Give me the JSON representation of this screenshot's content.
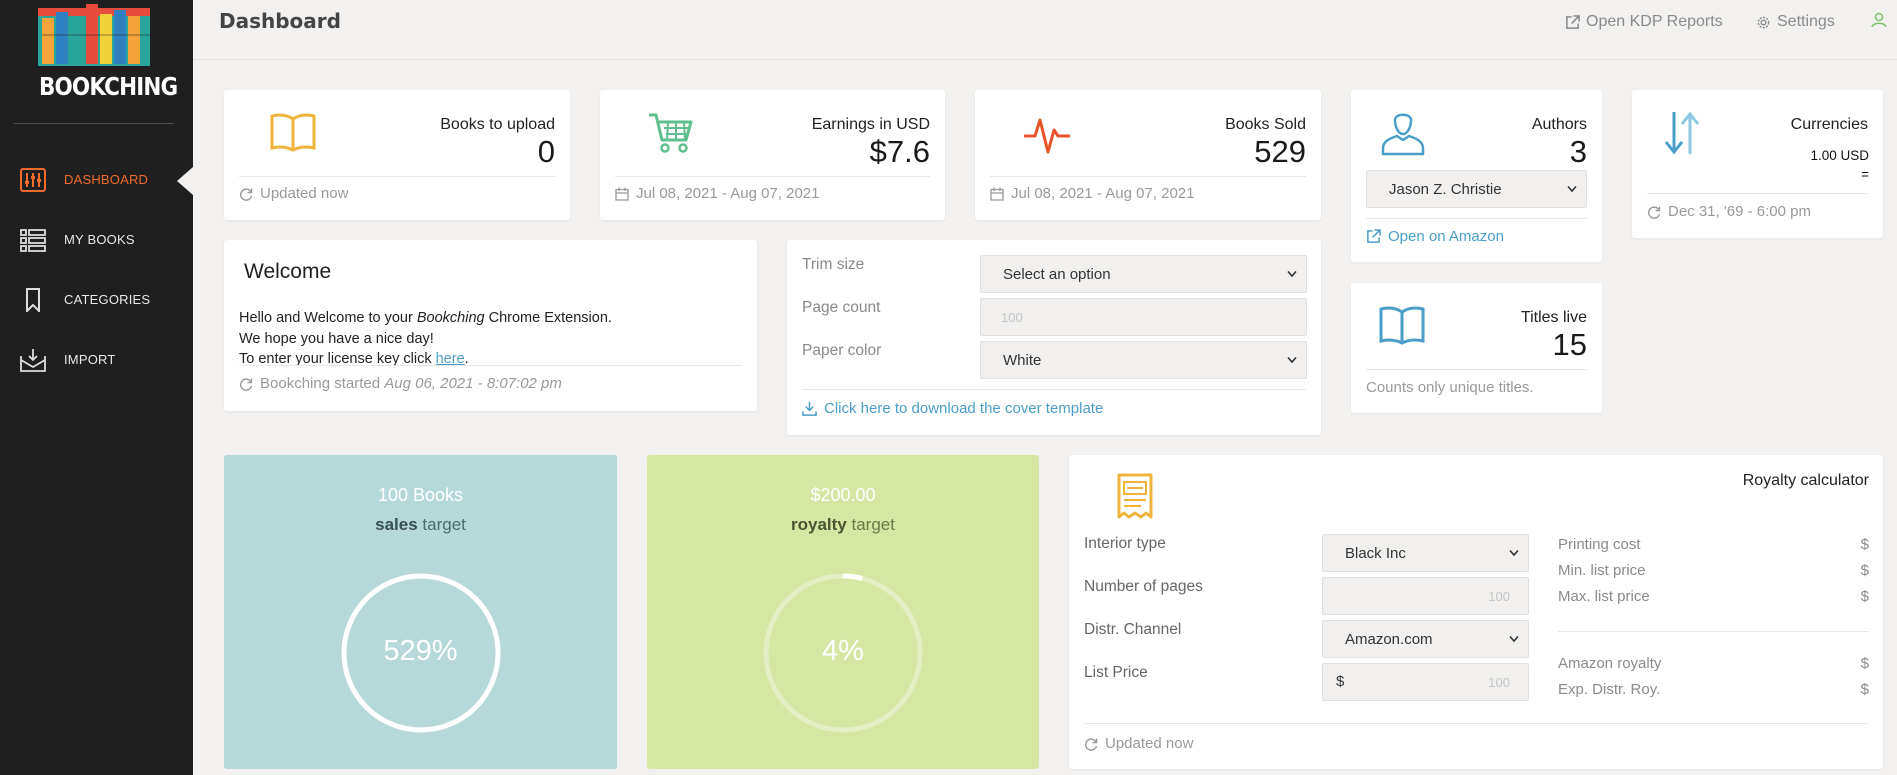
{
  "app": {
    "logo_text": "BOOKCHING"
  },
  "sidebar": {
    "items": [
      {
        "label": "DASHBOARD",
        "icon": "sliders-icon",
        "active": true
      },
      {
        "label": "MY BOOKS",
        "icon": "list-icon"
      },
      {
        "label": "CATEGORIES",
        "icon": "bookmark-icon"
      },
      {
        "label": "IMPORT",
        "icon": "inbox-icon"
      }
    ]
  },
  "header": {
    "title": "Dashboard",
    "links": {
      "kdp": "Open KDP Reports",
      "settings": "Settings"
    }
  },
  "stats": {
    "books_to_upload": {
      "title": "Books to upload",
      "value": "0",
      "footer": "Updated now"
    },
    "earnings": {
      "title": "Earnings in USD",
      "value": "$7.6",
      "footer": "Jul 08, 2021 - Aug 07, 2021"
    },
    "books_sold": {
      "title": "Books Sold",
      "value": "529",
      "footer": "Jul 08, 2021 - Aug 07, 2021"
    },
    "authors": {
      "title": "Authors",
      "value": "3",
      "selected_author": "Jason Z. Christie",
      "link": "Open on Amazon"
    },
    "currencies": {
      "title": "Currencies",
      "value": "1.00 USD",
      "eq": "=",
      "footer": "Dec 31, '69 - 6:00 pm"
    },
    "titles_live": {
      "title": "Titles live",
      "value": "15",
      "footer": "Counts only unique titles."
    }
  },
  "welcome": {
    "title": "Welcome",
    "line1_pre": "Hello and Welcome to your ",
    "line1_em": "Bookching",
    "line1_post": " Chrome Extension.",
    "line2": "We hope you have a nice day!",
    "line3_pre": "To enter your license key click ",
    "line3_link": "here",
    "line3_post": ".",
    "footer_pre": "Bookching started ",
    "footer_em": "Aug 06, 2021 - 8:07:02 pm"
  },
  "cover": {
    "trim_label": "Trim size",
    "trim_value": "Select an option",
    "page_label": "Page count",
    "page_placeholder": "100",
    "paper_label": "Paper color",
    "paper_value": "White",
    "download_link": "Click here to download the cover template"
  },
  "targets": {
    "sales": {
      "top": "100 Books",
      "bold": "sales",
      "rest": " target",
      "pct_text": "529%",
      "fraction": 1.0,
      "bg": "#b7d8d9"
    },
    "royalty": {
      "top": "$200.00",
      "bold": "royalty",
      "rest": " target",
      "pct_text": "4%",
      "fraction": 0.04,
      "bg": "#d6e7a4"
    }
  },
  "calculator": {
    "title": "Royalty calculator",
    "interior_label": "Interior type",
    "interior_value": "Black Inc",
    "pages_label": "Number of pages",
    "pages_placeholder": "100",
    "channel_label": "Distr. Channel",
    "channel_value": "Amazon.com",
    "price_label": "List Price",
    "price_prefix": "$",
    "price_placeholder": "100",
    "right": [
      {
        "label": "Printing cost",
        "value": "$"
      },
      {
        "label": "Min. list price",
        "value": "$"
      },
      {
        "label": "Max. list price",
        "value": "$"
      },
      {
        "label": "Amazon royalty",
        "value": "$"
      },
      {
        "label": "Exp. Distr. Roy.",
        "value": "$"
      }
    ],
    "footer": "Updated now"
  },
  "colors": {
    "accent_orange": "#f26b2a",
    "book_yellow": "#f0b43c",
    "cart_green": "#5fbf8f",
    "pulse_red": "#e8532a",
    "user_blue": "#4a9ec9",
    "link_blue": "#4a9ec9"
  }
}
